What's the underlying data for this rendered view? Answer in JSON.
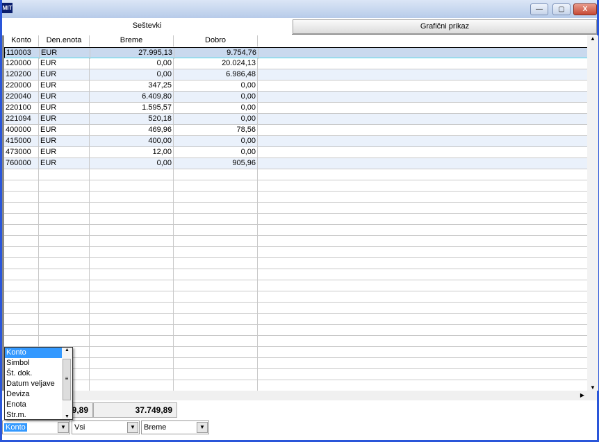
{
  "window": {
    "logo": "MIT",
    "minimize": "—",
    "maximize": "▢",
    "close": "X"
  },
  "tabs": [
    {
      "label": "Seštevki",
      "active": true
    },
    {
      "label": "Grafični prikaz",
      "active": false
    }
  ],
  "grid": {
    "columns": [
      "Konto",
      "Den.enota",
      "Breme",
      "Dobro"
    ],
    "rows": [
      [
        "110003",
        "EUR",
        "27.995,13",
        "9.754,76"
      ],
      [
        "120000",
        "EUR",
        "0,00",
        "20.024,13"
      ],
      [
        "120200",
        "EUR",
        "0,00",
        "6.986,48"
      ],
      [
        "220000",
        "EUR",
        "347,25",
        "0,00"
      ],
      [
        "220040",
        "EUR",
        "6.409,80",
        "0,00"
      ],
      [
        "220100",
        "EUR",
        "1.595,57",
        "0,00"
      ],
      [
        "221094",
        "EUR",
        "520,18",
        "0,00"
      ],
      [
        "400000",
        "EUR",
        "469,96",
        "78,56"
      ],
      [
        "415000",
        "EUR",
        "400,00",
        "0,00"
      ],
      [
        "473000",
        "EUR",
        "12,00",
        "0,00"
      ],
      [
        "760000",
        "EUR",
        "0,00",
        "905,96"
      ]
    ],
    "selected_row": 0
  },
  "totals": {
    "breme": "37.749,89",
    "dobro": "37.749,89"
  },
  "filters": {
    "group_by": "Konto",
    "scope": "Vsi",
    "side": "Breme"
  },
  "dropdown_list": {
    "items": [
      "Konto",
      "Simbol",
      "Št. dok.",
      "Datum veljave",
      "Deviza",
      "Enota",
      "Str.m."
    ],
    "highlighted": 0
  },
  "colors": {
    "selection": "#3399ff",
    "alt_row": "#eaf1fb",
    "selected_row": "#c9d9ee"
  }
}
